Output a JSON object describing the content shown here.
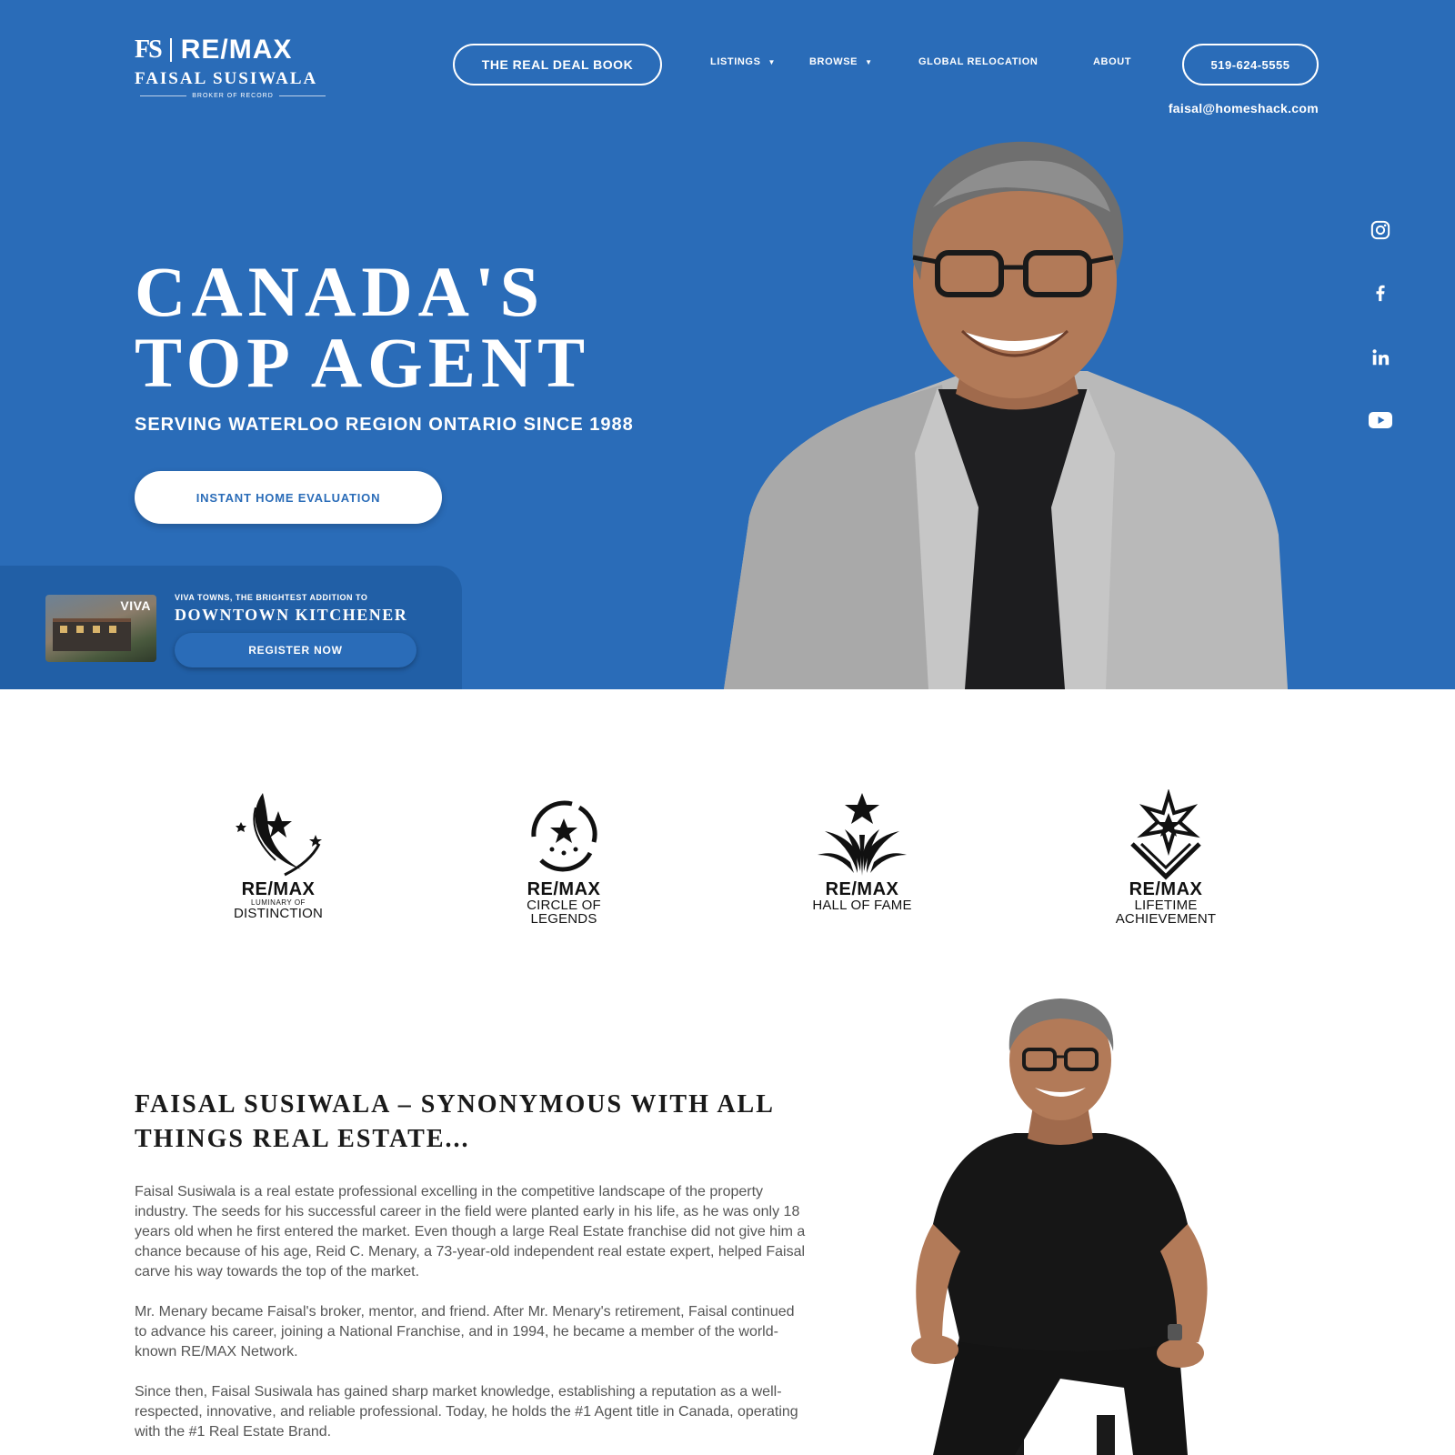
{
  "brand": {
    "monogram": "FS",
    "remax": "RE/MAX",
    "name": "FAISAL SUSIWALA",
    "subtitle": "BROKER OF RECORD"
  },
  "nav": {
    "book_label": "THE REAL DEAL BOOK",
    "items": [
      {
        "label": "LISTINGS",
        "has_dropdown": true
      },
      {
        "label": "BROWSE",
        "has_dropdown": true
      },
      {
        "label": "GLOBAL RELOCATION",
        "has_dropdown": false
      },
      {
        "label": "ABOUT",
        "has_dropdown": false
      }
    ],
    "phone": "519-624-5555",
    "email": "faisal@homeshack.com"
  },
  "social": [
    "instagram-icon",
    "facebook-icon",
    "linkedin-icon",
    "youtube-icon"
  ],
  "hero": {
    "headline_line1": "CANADA'S",
    "headline_line2": "TOP AGENT",
    "tagline": "SERVING WATERLOO REGION ONTARIO SINCE 1988",
    "cta_label": "INSTANT HOME EVALUATION"
  },
  "promo": {
    "image_label": "VIVA",
    "kicker": "VIVA TOWNS, THE BRIGHTEST ADDITION TO",
    "title": "DOWNTOWN KITCHENER",
    "cta_label": "REGISTER NOW"
  },
  "awards": [
    {
      "brand": "RE/MAX",
      "line1": "LUMINARY OF",
      "line2": "DISTINCTION"
    },
    {
      "brand": "RE/MAX",
      "line1": "CIRCLE OF",
      "line2": "LEGENDS"
    },
    {
      "brand": "RE/MAX",
      "line1": "HALL OF FAME",
      "line2": ""
    },
    {
      "brand": "RE/MAX",
      "line1": "LIFETIME",
      "line2": "ACHIEVEMENT"
    }
  ],
  "about": {
    "title": "FAISAL SUSIWALA – SYNONYMOUS WITH ALL THINGS REAL ESTATE...",
    "paragraphs": [
      "Faisal Susiwala is a real estate professional excelling in the competitive landscape of the property industry. The seeds for his successful career in the field were planted early in his life, as he was only 18 years old when he first entered the market. Even though a large Real Estate franchise did not give him a chance because of his age, Reid C. Menary, a 73-year-old independent real estate expert, helped Faisal carve his way towards the top of the market.",
      "Mr. Menary became Faisal's broker, mentor, and friend. After Mr. Menary's retirement, Faisal continued to advance his career, joining a National Franchise, and in 1994, he became a member of the world-known RE/MAX Network.",
      "Since then, Faisal Susiwala has gained sharp market knowledge, establishing a reputation as a well-respected, innovative, and reliable professional. Today, he holds the #1 Agent title in Canada, operating with the #1 Real Estate Brand."
    ]
  },
  "colors": {
    "hero_blue": "#2a6cb8",
    "promo_blue": "#215fa6",
    "white": "#ffffff",
    "text_dark": "#1a1a1a"
  }
}
